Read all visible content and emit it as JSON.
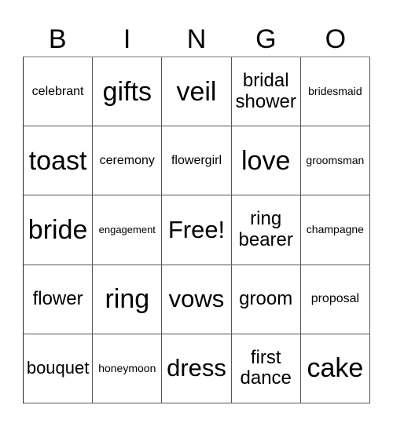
{
  "header": [
    "B",
    "I",
    "N",
    "G",
    "O"
  ],
  "cells": [
    [
      "celebrant",
      "gifts",
      "veil",
      "bridal shower",
      "bridesmaid"
    ],
    [
      "toast",
      "ceremony",
      "flowergirl",
      "love",
      "groomsman"
    ],
    [
      "bride",
      "engagement",
      "Free!",
      "ring bearer",
      "champagne"
    ],
    [
      "flower",
      "ring",
      "vows",
      "groom",
      "proposal"
    ],
    [
      "bouquet",
      "honeymoon",
      "dress",
      "first dance",
      "cake"
    ]
  ]
}
